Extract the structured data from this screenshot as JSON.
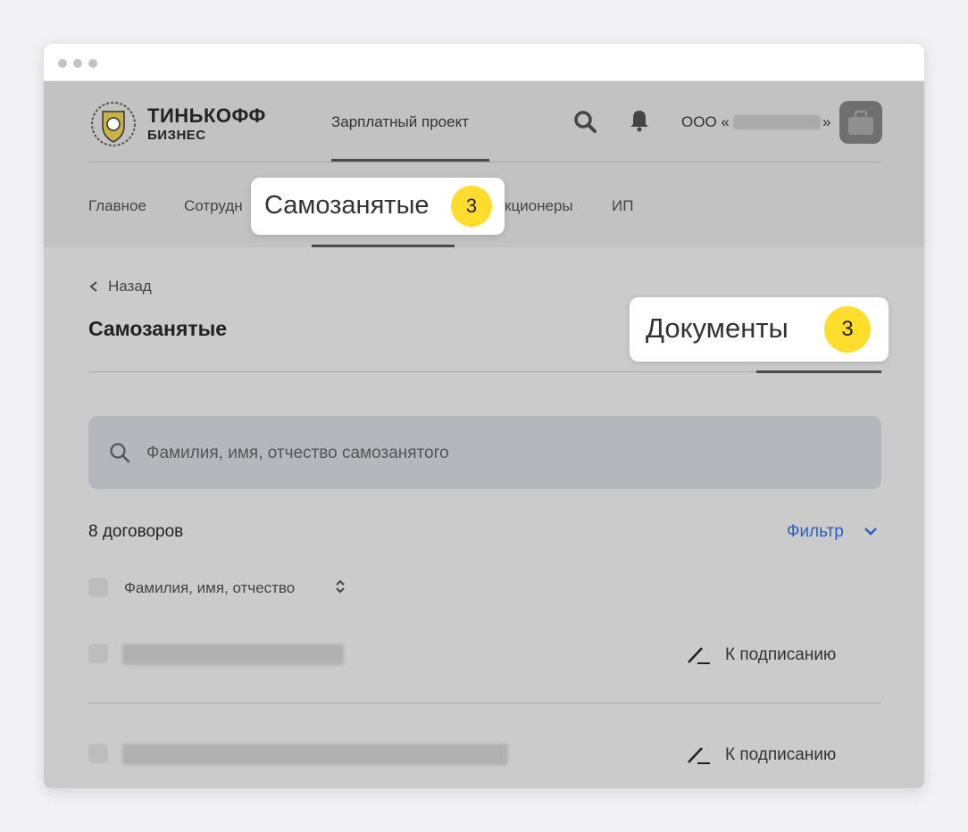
{
  "header": {
    "logo_line1": "ТИНЬКОФФ",
    "logo_line2": "БИЗНЕС",
    "product": "Зарплатный проект",
    "org_prefix": "ООО «",
    "org_suffix": "»"
  },
  "nav": {
    "items": [
      {
        "label": "Главное"
      },
      {
        "label": "Сотрудн"
      },
      {
        "label": "кционеры"
      },
      {
        "label": "ИП"
      }
    ]
  },
  "callouts": {
    "selfemployed": {
      "label": "Самозанятые",
      "badge": "3"
    },
    "documents": {
      "label": "Документы",
      "badge": "3"
    }
  },
  "page": {
    "back_label": "Назад",
    "title": "Самозанятые"
  },
  "search": {
    "placeholder": "Фамилия, имя, отчество самозанятого"
  },
  "list": {
    "count_label": "8 договоров",
    "filter_label": "Фильтр",
    "column_header": "Фамилия, имя, отчество",
    "rows": [
      {
        "status": "К подписанию"
      },
      {
        "status": "К подписанию"
      }
    ]
  },
  "colors": {
    "accent_yellow": "#ffdd2d",
    "link_blue": "#2c5fc4"
  }
}
